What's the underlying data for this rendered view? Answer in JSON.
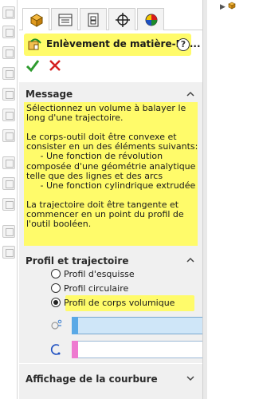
{
  "property_manager": {
    "feature_title": "Enlèvement de matière-Ba...",
    "help_symbol": "?",
    "tabs": [
      {
        "icon": "feature-manager-icon",
        "active": true
      },
      {
        "icon": "property-manager-icon",
        "active": false
      },
      {
        "icon": "configuration-manager-icon",
        "active": false
      },
      {
        "icon": "dimxpert-manager-icon",
        "active": false
      },
      {
        "icon": "display-manager-icon",
        "active": false
      }
    ]
  },
  "message_section": {
    "title": "Message",
    "lines": [
      "Sélectionnez un volume à balayer le",
      "long d'une trajectoire.",
      "",
      "Le corps-outil doit être convexe et",
      "consister en un des éléments suivants:",
      "     - Une fonction de révolution",
      "composée d'une géométrie analytique",
      "telle que des lignes et des arcs",
      "     - Une fonction cylindrique extrudée",
      "",
      "La trajectoire doit être tangente et",
      "commencer en un point du profil de",
      "l'outil booléen."
    ]
  },
  "profile_section": {
    "title": "Profil et trajectoire",
    "options": [
      {
        "label": "Profil d'esquisse",
        "selected": false
      },
      {
        "label": "Profil circulaire",
        "selected": false
      },
      {
        "label": "Profil de corps volumique",
        "selected": true
      }
    ],
    "fields": [
      {
        "name": "tool-body-selection",
        "value": "",
        "swatch_color": "#5aa9e6"
      },
      {
        "name": "path-selection",
        "value": "",
        "swatch_color": "#ee7ad0"
      }
    ]
  },
  "curvature_section": {
    "title": "Affichage de la courbure"
  },
  "colors": {
    "highlight": "#fffb6a",
    "section_bg": "#f0f0f0",
    "ok_green": "#2e9b2e",
    "cancel_red": "#d42020"
  }
}
